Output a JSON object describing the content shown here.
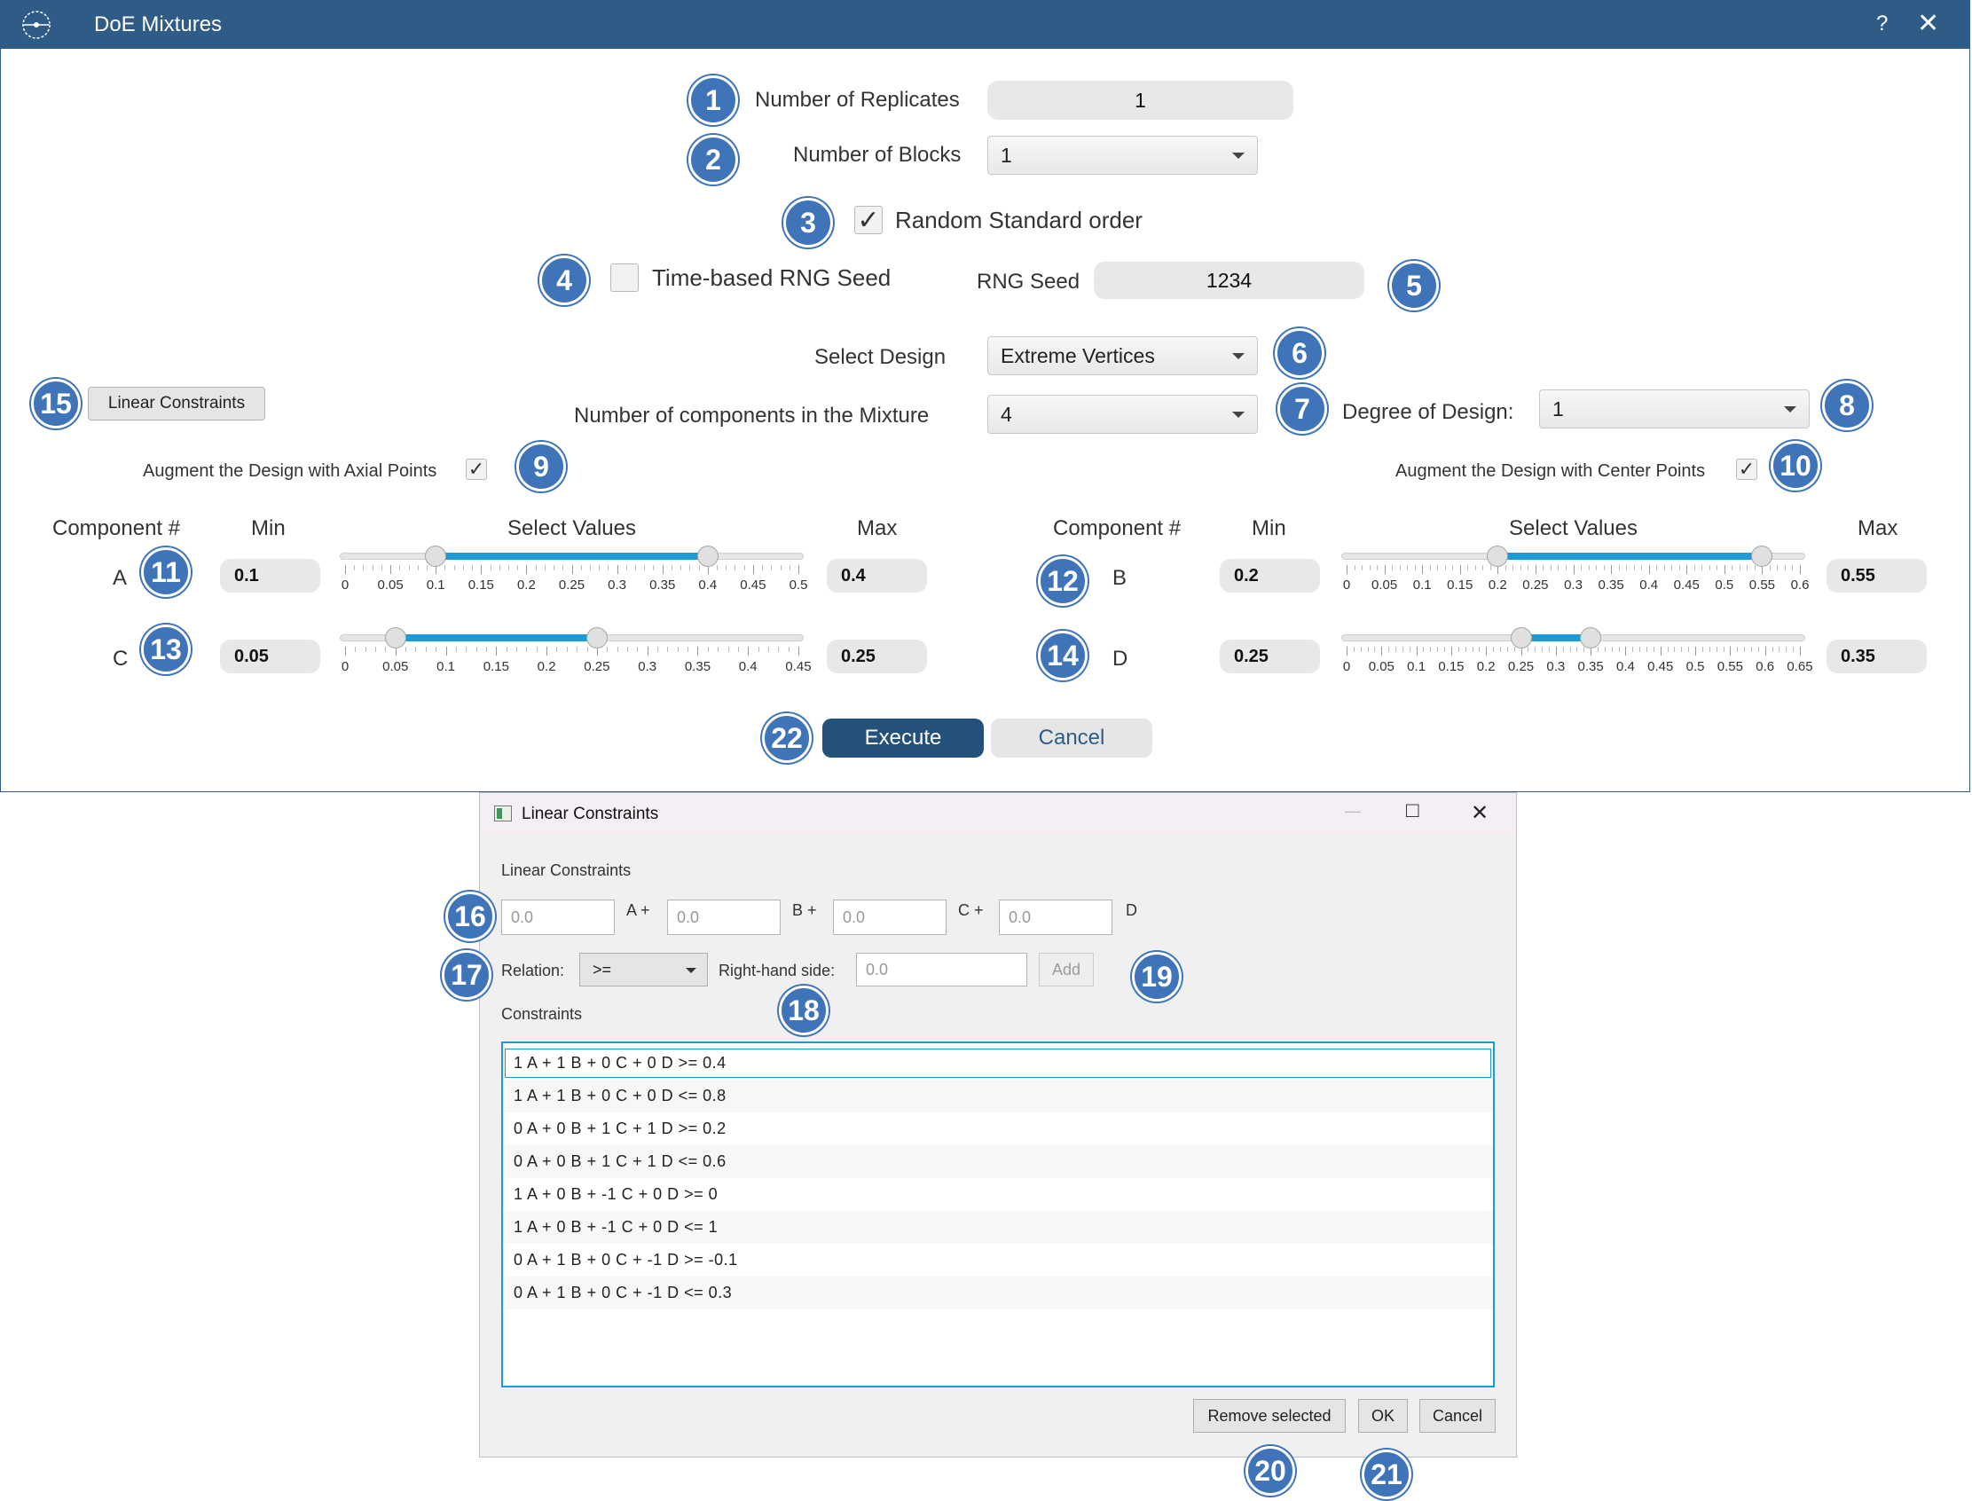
{
  "main": {
    "title": "DoE Mixtures",
    "help_icon": "?",
    "close_icon": "✕",
    "replicates_label": "Number of Replicates",
    "replicates_value": "1",
    "blocks_label": "Number of Blocks",
    "blocks_value": "1",
    "random_std_order_label": "Random Standard order",
    "random_std_order_checked": true,
    "time_rng_label": "Time-based RNG Seed",
    "time_rng_checked": false,
    "rng_seed_label": "RNG Seed",
    "rng_seed_value": "1234",
    "select_design_label": "Select Design",
    "select_design_value": "Extreme Vertices",
    "linear_constraints_button": "Linear Constraints",
    "num_components_label": "Number of components in the Mixture",
    "num_components_value": "4",
    "degree_label": "Degree of Design:",
    "degree_value": "1",
    "axial_label": "Augment the Design with Axial Points",
    "axial_checked": true,
    "center_label": "Augment the Design with Center Points",
    "center_checked": true,
    "headers": {
      "component": "Component #",
      "min": "Min",
      "select": "Select Values",
      "max": "Max"
    },
    "components": [
      {
        "name": "A",
        "min": "0.1",
        "max": "0.4",
        "ticks": [
          "0",
          "0.05",
          "0.1",
          "0.15",
          "0.2",
          "0.25",
          "0.3",
          "0.35",
          "0.4",
          "0.45",
          "0.5"
        ],
        "range": [
          0,
          0.5
        ]
      },
      {
        "name": "B",
        "min": "0.2",
        "max": "0.55",
        "ticks": [
          "0",
          "0.05",
          "0.1",
          "0.15",
          "0.2",
          "0.25",
          "0.3",
          "0.35",
          "0.4",
          "0.45",
          "0.5",
          "0.55",
          "0.6"
        ],
        "range": [
          0,
          0.6
        ]
      },
      {
        "name": "C",
        "min": "0.05",
        "max": "0.25",
        "ticks": [
          "0",
          "0.05",
          "0.1",
          "0.15",
          "0.2",
          "0.25",
          "0.3",
          "0.35",
          "0.4",
          "0.45"
        ],
        "range": [
          0,
          0.45
        ]
      },
      {
        "name": "D",
        "min": "0.25",
        "max": "0.35",
        "ticks": [
          "0",
          "0.05",
          "0.1",
          "0.15",
          "0.2",
          "0.25",
          "0.3",
          "0.35",
          "0.4",
          "0.45",
          "0.5",
          "0.55",
          "0.6",
          "0.65"
        ],
        "range": [
          0,
          0.65
        ]
      }
    ],
    "execute_button": "Execute",
    "cancel_button": "Cancel"
  },
  "badges": [
    "1",
    "2",
    "3",
    "4",
    "5",
    "6",
    "7",
    "8",
    "9",
    "10",
    "11",
    "12",
    "13",
    "14",
    "15",
    "16",
    "17",
    "18",
    "19",
    "20",
    "21",
    "22"
  ],
  "dialog": {
    "title": "Linear Constraints",
    "minimize_icon": "—",
    "maximize_icon": "□",
    "close_icon": "✕",
    "section_label": "Linear Constraints",
    "coef_placeholder": "0.0",
    "coef_A_suffix": "A  +",
    "coef_B_suffix": "B  +",
    "coef_C_suffix": "C  +",
    "coef_D_suffix": "D",
    "relation_label": "Relation:",
    "relation_value": ">=",
    "rhs_label": "Right-hand side:",
    "rhs_placeholder": "0.0",
    "add_button": "Add",
    "constraints_label": "Constraints",
    "constraints": [
      "1 A + 1 B + 0 C + 0 D >= 0.4",
      "1 A + 1 B + 0 C + 0 D <= 0.8",
      "0 A + 0 B + 1 C + 1 D >= 0.2",
      "0 A + 0 B + 1 C + 1 D <= 0.6",
      "1 A + 0 B + -1 C + 0 D >= 0",
      "1 A + 0 B + -1 C + 0 D <= 1",
      "0 A + 1 B + 0 C + -1 D >= -0.1",
      "0 A + 1 B + 0 C + -1 D <= 0.3"
    ],
    "remove_button": "Remove selected",
    "ok_button": "OK",
    "cancel_button": "Cancel"
  },
  "colors": {
    "titlebar": "#2e5c87",
    "badge": "#3f74b9",
    "accent": "#1a9ad6",
    "execute": "#24517a"
  }
}
